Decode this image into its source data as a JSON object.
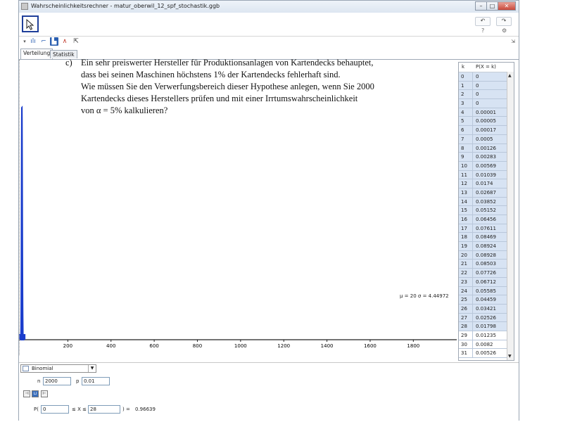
{
  "window": {
    "title": "Wahrscheinlichkeitsrechner - matur_oberwil_12_spf_stochastik.ggb"
  },
  "titlebar_buttons": {
    "minimize": "–",
    "maximize": "□",
    "close": "✕"
  },
  "toolbar": {
    "undo": "↶",
    "redo": "↷",
    "help": "?",
    "settings": "⚙"
  },
  "tabs": {
    "distribution": "Verteilung",
    "statistics": "Statistik"
  },
  "problem": {
    "label": "c)",
    "lines": [
      "Ein sehr preiswerter Hersteller für Produktionsanlagen von Kartendecks behauptet,",
      "dass bei seinen Maschinen höchstens  1%  der Kartendecks fehlerhaft sind.",
      "Wie müssen Sie den Verwerfungsbereich dieser Hypothese anlegen, wenn Sie  2000",
      "Kartendecks dieses Herstellers prüfen und mit einer Irrtumswahrscheinlichkeit",
      "von   α  =  5%  kalkulieren?"
    ]
  },
  "chart_data": {
    "type": "bar",
    "x_ticks": [
      200,
      400,
      600,
      800,
      1000,
      1200,
      1400,
      1600,
      1800
    ],
    "xlim": [
      0,
      2000
    ],
    "peak_k": 20,
    "peak_p": 0.08928,
    "stats_text": "μ = 20   σ = 4.44972"
  },
  "table": {
    "headers": [
      "k",
      "P(X = k)"
    ],
    "rows": [
      [
        "0",
        "0"
      ],
      [
        "1",
        "0"
      ],
      [
        "2",
        "0"
      ],
      [
        "3",
        "0"
      ],
      [
        "4",
        "0.00001"
      ],
      [
        "5",
        "0.00005"
      ],
      [
        "6",
        "0.00017"
      ],
      [
        "7",
        "0.0005"
      ],
      [
        "8",
        "0.00126"
      ],
      [
        "9",
        "0.00283"
      ],
      [
        "10",
        "0.00569"
      ],
      [
        "11",
        "0.01039"
      ],
      [
        "12",
        "0.0174"
      ],
      [
        "13",
        "0.02687"
      ],
      [
        "14",
        "0.03852"
      ],
      [
        "15",
        "0.05152"
      ],
      [
        "16",
        "0.06456"
      ],
      [
        "17",
        "0.07611"
      ],
      [
        "18",
        "0.08469"
      ],
      [
        "19",
        "0.08924"
      ],
      [
        "20",
        "0.08928"
      ],
      [
        "21",
        "0.08503"
      ],
      [
        "22",
        "0.07726"
      ],
      [
        "23",
        "0.06712"
      ],
      [
        "24",
        "0.05585"
      ],
      [
        "25",
        "0.04459"
      ],
      [
        "26",
        "0.03421"
      ],
      [
        "27",
        "0.02526"
      ],
      [
        "28",
        "0.01798"
      ],
      [
        "29",
        "0.01235"
      ],
      [
        "30",
        "0.0082"
      ],
      [
        "31",
        "0.00526"
      ]
    ],
    "highlight_until_k": 28
  },
  "distribution": {
    "selected": "Binomial"
  },
  "params": {
    "n_label": "n",
    "n_value": "2000",
    "p_label": "p",
    "p_value": "0.01"
  },
  "probability": {
    "prefix": "P(",
    "lower": "0",
    "middle": "≤ X ≤",
    "upper": "28",
    "suffix": ") =",
    "result": "0.96639"
  }
}
